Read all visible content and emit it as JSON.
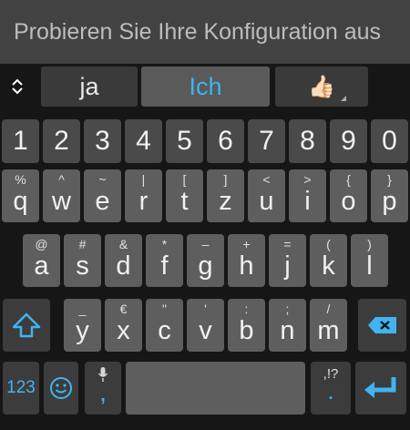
{
  "input": {
    "placeholder": "Probieren Sie Ihre Konfiguration aus"
  },
  "suggestions": [
    "ja",
    "Ich",
    "👍🏻"
  ],
  "colors": {
    "accent": "#41b3f2",
    "key": "#5e5e5e",
    "key_dark": "#3c3c3c",
    "keyboard_bg": "#161616"
  },
  "icons": {
    "expand": "chevron-up-down-icon",
    "shift": "shift-icon",
    "backspace": "backspace-icon",
    "emoji": "emoji-smiley-icon",
    "mic": "microphone-icon",
    "enter": "enter-icon"
  },
  "rows": {
    "numbers": [
      "1",
      "2",
      "3",
      "4",
      "5",
      "6",
      "7",
      "8",
      "9",
      "0"
    ],
    "row1": [
      {
        "hint": "%",
        "main": "q"
      },
      {
        "hint": "^",
        "main": "w"
      },
      {
        "hint": "~",
        "main": "e"
      },
      {
        "hint": "|",
        "main": "r"
      },
      {
        "hint": "[",
        "main": "t"
      },
      {
        "hint": "]",
        "main": "z"
      },
      {
        "hint": "<",
        "main": "u"
      },
      {
        "hint": ">",
        "main": "i"
      },
      {
        "hint": "{",
        "main": "o"
      },
      {
        "hint": "}",
        "main": "p"
      }
    ],
    "row2": [
      {
        "hint": "@",
        "main": "a"
      },
      {
        "hint": "#",
        "main": "s"
      },
      {
        "hint": "&",
        "main": "d"
      },
      {
        "hint": "*",
        "main": "f"
      },
      {
        "hint": "–",
        "main": "g"
      },
      {
        "hint": "+",
        "main": "h"
      },
      {
        "hint": "=",
        "main": "j"
      },
      {
        "hint": "(",
        "main": "k"
      },
      {
        "hint": ")",
        "main": "l"
      }
    ],
    "row3": [
      {
        "hint": "_",
        "main": "y"
      },
      {
        "hint": "€",
        "main": "x"
      },
      {
        "hint": "\"",
        "main": "c"
      },
      {
        "hint": "'",
        "main": "v"
      },
      {
        "hint": ":",
        "main": "b"
      },
      {
        "hint": ";",
        "main": "n"
      },
      {
        "hint": "/",
        "main": "m"
      }
    ]
  },
  "bottom": {
    "symbols_label": "123",
    "comma": ",",
    "punct_hint": ",!?",
    "period": "."
  }
}
